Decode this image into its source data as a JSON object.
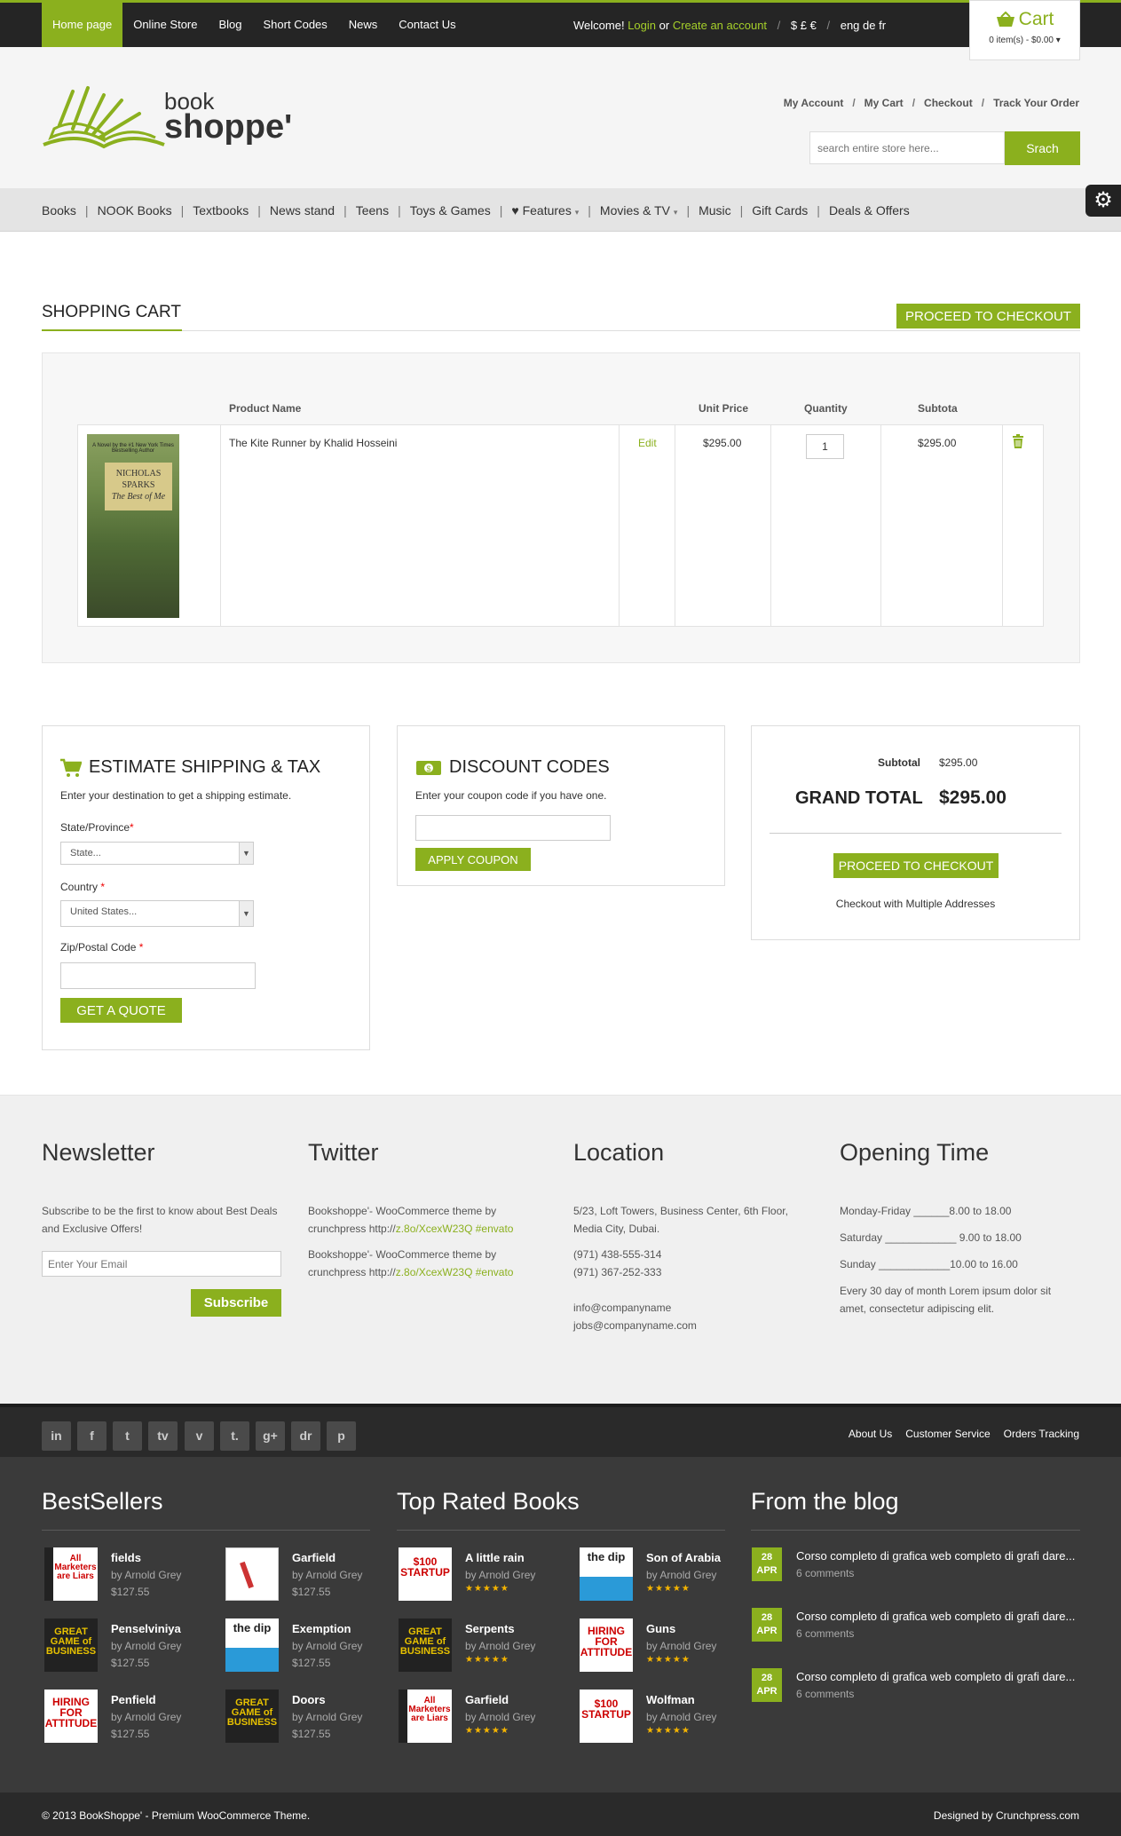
{
  "topnav": [
    "Home page",
    "Online Store",
    "Blog",
    "Short Codes",
    "News",
    "Contact Us"
  ],
  "welcome": {
    "text": "Welcome!",
    "login": "Login",
    "or": "or",
    "create": "Create an account",
    "sep": "/",
    "currencies": "$ £ €",
    "languages": "eng de fr"
  },
  "cart": {
    "title": "Cart",
    "summary": "0 item(s) - $0.00"
  },
  "logo": {
    "top": "book",
    "bottom": "shoppe'"
  },
  "toplinks": [
    "My Account",
    "My Cart",
    "Checkout",
    "Track Your Order"
  ],
  "search": {
    "placeholder": "search entire store here...",
    "button": "Srach"
  },
  "mainnav": [
    "Books",
    "NOOK Books",
    "Textbooks",
    "News stand",
    "Teens",
    "Toys & Games",
    "Features",
    "Movies & TV",
    "Music",
    "Gift Cards",
    "Deals & Offers"
  ],
  "cart_page": {
    "title": "Shopping Cart",
    "proceed": "Proceed to Checkout",
    "headers": {
      "name": "Product Name",
      "price": "Unit Price",
      "qty": "Quantity",
      "subtotal": "Subtota"
    },
    "row": {
      "name": "The Kite Runner by Khalid Hosseini",
      "edit": "Edit",
      "price": "$295.00",
      "qty": "1",
      "subtotal": "$295.00"
    },
    "cover": {
      "blurb": "A Novel by the #1 New York Times Bestselling Author",
      "author": "NICHOLAS SPARKS",
      "title": "The Best of Me"
    }
  },
  "shipping": {
    "title": "Estimate Shipping & Tax",
    "intro": "Enter your destination to get a shipping estimate.",
    "state_label": "State/Province",
    "state_value": "State...",
    "country_label": "Country",
    "country_value": "United States...",
    "zip_label": "Zip/Postal Code",
    "button": "Get a Quote"
  },
  "discount": {
    "title": "Discount Codes",
    "intro": "Enter your coupon code if you have one.",
    "button": "Apply Coupon"
  },
  "totals": {
    "subtotal_label": "Subtotal",
    "subtotal": "$295.00",
    "grand_label": "GRAND TOTAL",
    "grand": "$295.00",
    "button": "Proceed to Checkout",
    "multi": "Checkout with Multiple Addresses"
  },
  "footer": {
    "newsletter": {
      "title": "Newsletter",
      "text": "Subscribe to be the first to know about Best Deals and Exclusive Offers!",
      "placeholder": "Enter Your Email",
      "button": "Subscribe"
    },
    "twitter": {
      "title": "Twitter",
      "tweets": [
        {
          "text": "Bookshoppe'- WooCommerce theme by crunchpress http://",
          "link": "z.8o/XcexW23Q #envato"
        },
        {
          "text": "Bookshoppe'- WooCommerce theme by crunchpress http://",
          "link": "z.8o/XcexW23Q #envato"
        }
      ]
    },
    "location": {
      "title": "Location",
      "address": "5/23, Loft Towers, Business Center, 6th Floor, Media City, Dubai.",
      "phone1": "(971) 438-555-314",
      "phone2": "(971) 367-252-333",
      "email1": "info@companyname",
      "email2": "jobs@companyname.com"
    },
    "opening": {
      "title": "Opening Time",
      "rows": [
        "Monday-Friday ______8.00 to 18.00",
        "Saturday ____________ 9.00 to 18.00",
        "Sunday ____________10.00 to 16.00"
      ],
      "text": "Every 30 day of month Lorem ipsum dolor sit amet, consectetur adipiscing elit."
    }
  },
  "social": [
    "in",
    "f",
    "t",
    "tv",
    "v",
    "t.",
    "g+",
    "dr",
    "p"
  ],
  "footlinks": [
    "About Us",
    "Customer Service",
    "Orders Tracking"
  ],
  "bestsellers": {
    "title": "BestSellers",
    "items": [
      {
        "t": "fields",
        "a": "by Arnold Grey",
        "p": "$127.55",
        "cover": "All Marketers are Liars"
      },
      {
        "t": "Garfield",
        "a": "by Arnold Grey",
        "p": "$127.55",
        "cover": ""
      },
      {
        "t": "Penselviniya",
        "a": "by Arnold Grey",
        "p": "$127.55",
        "cover": "GREAT GAME of BUSINESS"
      },
      {
        "t": "Exemption",
        "a": "by Arnold Grey",
        "p": "$127.55",
        "cover": "the dip"
      },
      {
        "t": "Penfield",
        "a": "by Arnold Grey",
        "p": "$127.55",
        "cover": "HIRING FOR ATTITUDE"
      },
      {
        "t": "Doors",
        "a": "by Arnold Grey",
        "p": "$127.55",
        "cover": "GREAT GAME of BUSINESS"
      }
    ]
  },
  "toprated": {
    "title": "Top Rated Books",
    "stars": "★★★★★",
    "items": [
      {
        "t": "A little rain",
        "a": "by Arnold Grey",
        "cover": "$100 STARTUP"
      },
      {
        "t": "Son of Arabia",
        "a": "by Arnold Grey",
        "cover": "the dip"
      },
      {
        "t": "Serpents",
        "a": "by Arnold Grey",
        "cover": "GREAT GAME of BUSINESS"
      },
      {
        "t": "Guns",
        "a": "by Arnold Grey",
        "cover": "HIRING FOR ATTITUDE"
      },
      {
        "t": "Garfield",
        "a": "by Arnold Grey",
        "cover": "All Marketers are Liars"
      },
      {
        "t": "Wolfman",
        "a": "by Arnold Grey",
        "cover": "$100 STARTUP"
      }
    ]
  },
  "blog": {
    "title": "From the blog",
    "posts": [
      {
        "day": "28",
        "mon": "APR",
        "t": "Corso completo di grafica web completo di grafi dare...",
        "c": "6 comments"
      },
      {
        "day": "28",
        "mon": "APR",
        "t": "Corso completo di grafica web completo di grafi dare...",
        "c": "6 comments"
      },
      {
        "day": "28",
        "mon": "APR",
        "t": "Corso completo di grafica web completo di grafi dare...",
        "c": "6 comments"
      }
    ]
  },
  "copyright": "© 2013 BookShoppe' - Premium WooCommerce Theme.",
  "designed": "Designed by Crunchpress.com",
  "colors": {
    "accent": "#8bb01e",
    "dark": "#252525"
  }
}
